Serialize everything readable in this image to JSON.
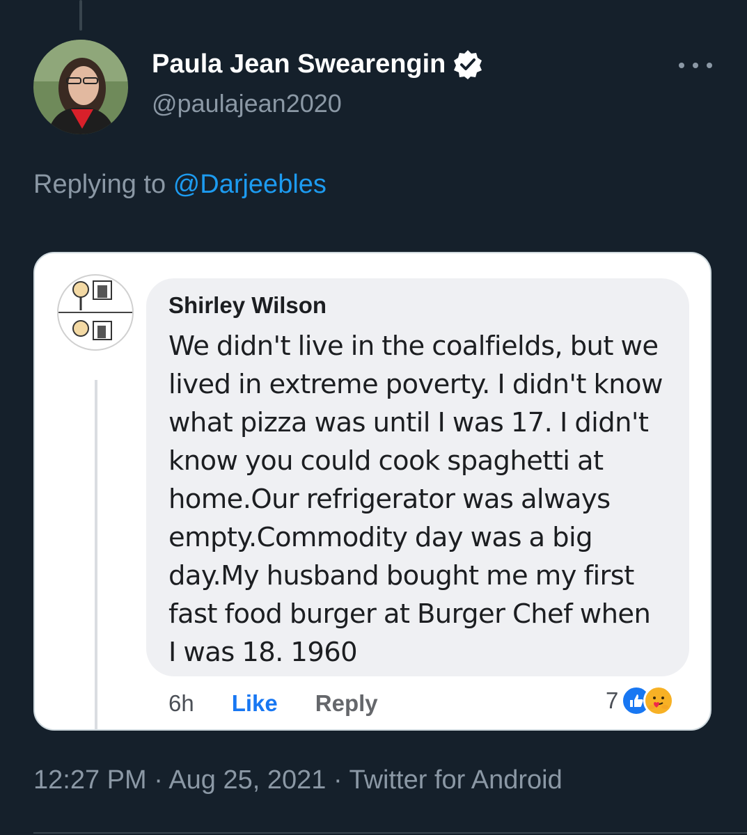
{
  "tweet": {
    "display_name": "Paula Jean Swearengin",
    "handle": "@paulajean2020",
    "replying_prefix": "Replying to ",
    "replying_to": "@Darjeebles",
    "timestamp": "12:27 PM · Aug 25, 2021 · Twitter for Android",
    "verified_icon": "verified-badge-icon",
    "more_icon": "more-dots-icon"
  },
  "embedded_comment": {
    "author": "Shirley Wilson",
    "text": "We didn't live in the coalfields, but we\nlived in extreme poverty. I didn't know\nwhat pizza was until I was 17. I didn't\nknow you could cook spaghetti at\nhome.Our refrigerator was always\nempty.Commodity day was a big\nday.My husband bought me my first\nfast food burger at Burger Chef when\nI was 18. 1960",
    "age": "6h",
    "like_label": "Like",
    "reply_label": "Reply",
    "reaction_count": "7",
    "reaction_icons": [
      "like-reaction-icon",
      "care-reaction-icon"
    ]
  },
  "colors": {
    "background": "#15202b",
    "accent": "#1d9bf0",
    "secondary_text": "#8b98a5",
    "fb_like_blue": "#1877f2"
  }
}
